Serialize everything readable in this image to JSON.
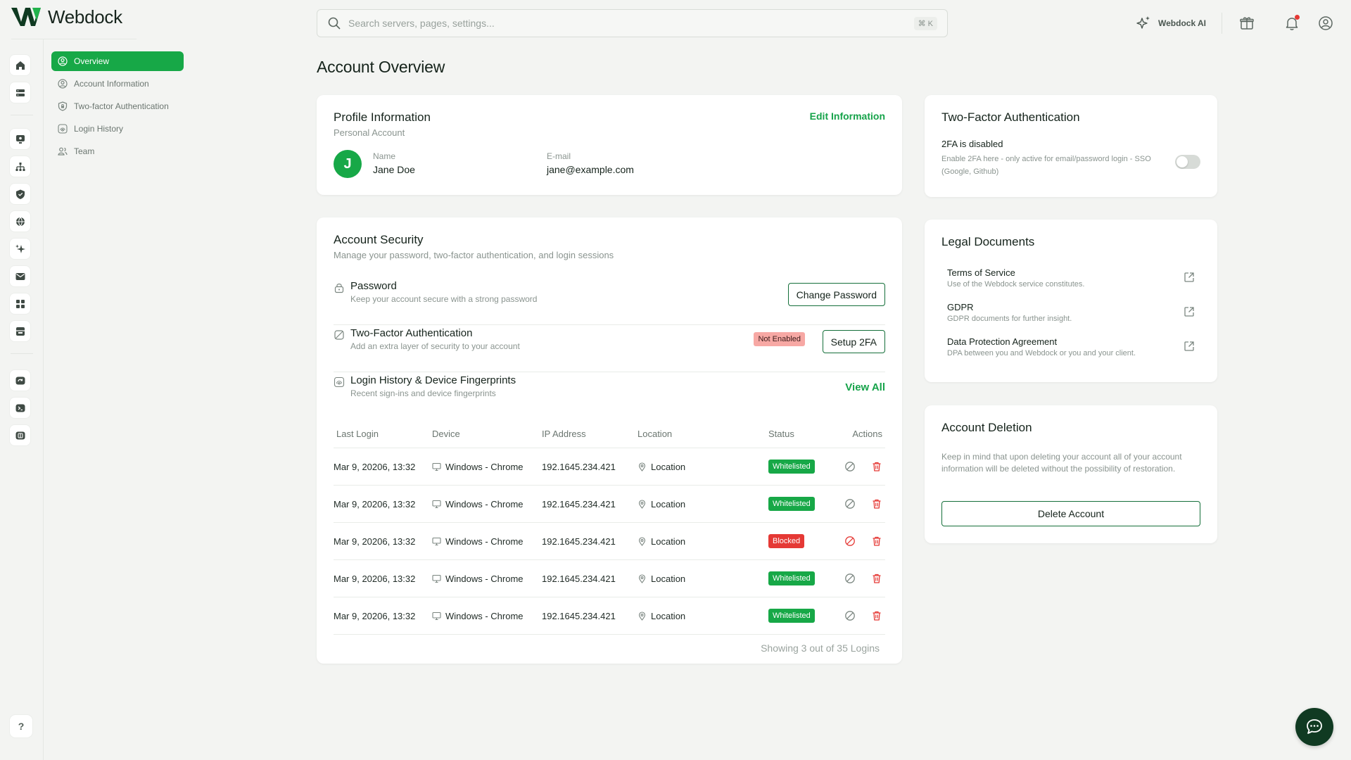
{
  "brand": {
    "name": "Webdock",
    "accent": "#17a847"
  },
  "sidebar_rail": {
    "icons": [
      "home-icon",
      "server-icon",
      "monitor-icon",
      "sitemap-icon",
      "shield-icon",
      "globe-icon",
      "sparkle-icon",
      "mail-icon",
      "apps-icon",
      "storage-icon",
      "backup-icon",
      "terminal-icon",
      "database-icon"
    ],
    "help_label": "?"
  },
  "subnav": {
    "items": [
      {
        "label": "Overview",
        "icon": "user-circle-icon",
        "active": true
      },
      {
        "label": "Account Information",
        "icon": "user-circle-icon",
        "active": false
      },
      {
        "label": "Two-factor Authentication",
        "icon": "shield-lock-icon",
        "active": false
      },
      {
        "label": "Login History",
        "icon": "fingerprint-icon",
        "active": false
      },
      {
        "label": "Team",
        "icon": "team-icon",
        "active": false
      }
    ]
  },
  "topbar": {
    "search_placeholder": "Search servers, pages, settings...",
    "search_shortcut": "⌘ K",
    "ai_label": "Webdock AI"
  },
  "page": {
    "title": "Account Overview"
  },
  "profile": {
    "title": "Profile Information",
    "subtitle": "Personal Account",
    "edit_label": "Edit Information",
    "avatar_initial": "J",
    "name_label": "Name",
    "name_value": "Jane Doe",
    "email_label": "E-mail",
    "email_value": "jane@example.com"
  },
  "security": {
    "title": "Account Security",
    "subtitle": "Manage your password, two-factor authentication, and login sessions",
    "password": {
      "title": "Password",
      "desc": "Keep your account secure with a strong password",
      "button": "Change Password"
    },
    "twofa": {
      "title": "Two-Factor Authentication",
      "desc": "Add an extra layer of security to your account",
      "badge": "Not Enabled",
      "button": "Setup 2FA"
    },
    "history": {
      "title": "Login History & Device Fingerprints",
      "desc": "Recent sign-ins and device fingerprints",
      "view_all": "View All"
    },
    "table": {
      "headers": [
        "Last Login",
        "Device",
        "IP Address",
        "Location",
        "Status",
        "Actions"
      ],
      "rows": [
        {
          "date": "Mar 9, 20206, 13:32",
          "device": "Windows - Chrome",
          "ip": "192.1645.234.421",
          "location": "Location",
          "status": "Whitelisted",
          "blocked": false
        },
        {
          "date": "Mar 9, 20206, 13:32",
          "device": "Windows - Chrome",
          "ip": "192.1645.234.421",
          "location": "Location",
          "status": "Whitelisted",
          "blocked": false
        },
        {
          "date": "Mar 9, 20206, 13:32",
          "device": "Windows - Chrome",
          "ip": "192.1645.234.421",
          "location": "Location",
          "status": "Blocked",
          "blocked": true
        },
        {
          "date": "Mar 9, 20206, 13:32",
          "device": "Windows - Chrome",
          "ip": "192.1645.234.421",
          "location": "Location",
          "status": "Whitelisted",
          "blocked": false
        },
        {
          "date": "Mar 9, 20206, 13:32",
          "device": "Windows - Chrome",
          "ip": "192.1645.234.421",
          "location": "Location",
          "status": "Whitelisted",
          "blocked": false
        }
      ],
      "footer": "Showing 3 out of 35 Logins"
    }
  },
  "twofa_card": {
    "title": "Two-Factor Authentication",
    "status": "2FA is disabled",
    "desc": "Enable 2FA here - only active for email/password login - SSO (Google, Github)",
    "enabled": false
  },
  "legal": {
    "title": "Legal Documents",
    "items": [
      {
        "name": "Terms of Service",
        "desc": "Use of the Webdock service constitutes."
      },
      {
        "name": "GDPR",
        "desc": "GDPR  documents for further insight."
      },
      {
        "name": "Data Protection Agreement",
        "desc": "DPA between you and Webdock or you and your client."
      }
    ]
  },
  "deletion": {
    "title": "Account Deletion",
    "desc": "Keep in mind that upon deleting your account all of your account information will be deleted without the possibility of restoration.",
    "button": "Delete Account"
  }
}
